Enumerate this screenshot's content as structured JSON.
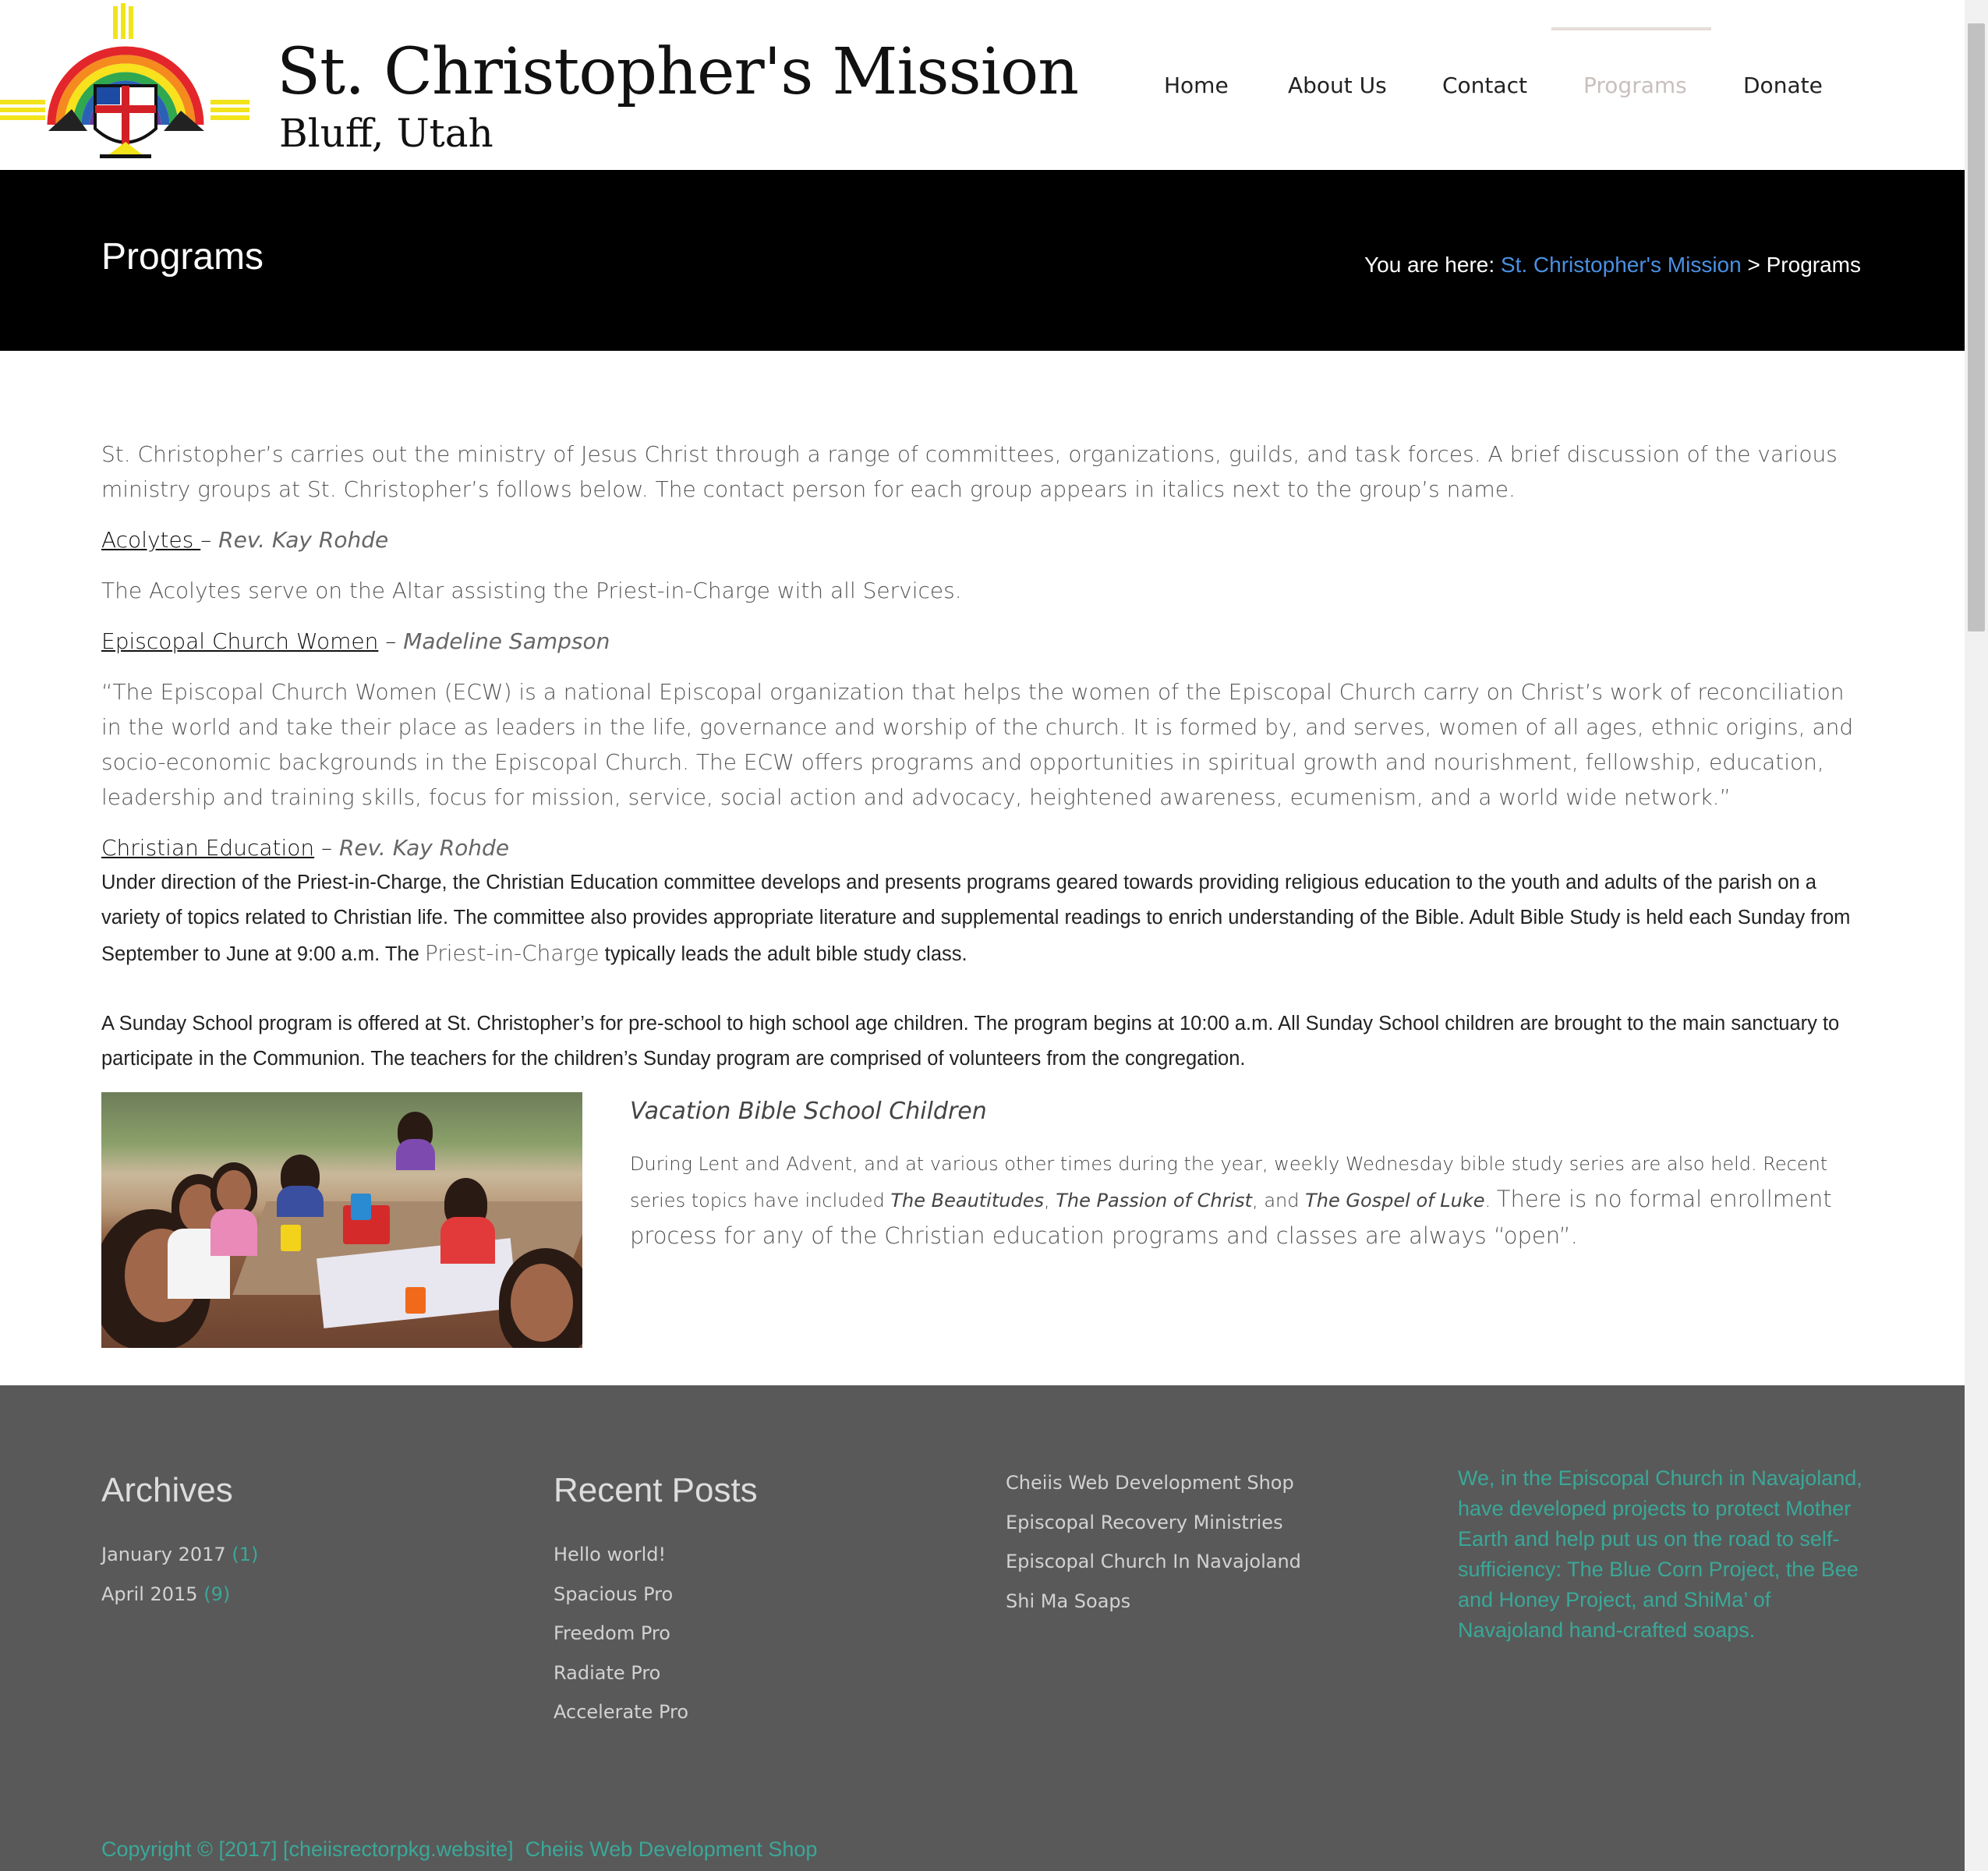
{
  "site": {
    "title": "St. Christopher's Mission",
    "tagline": "Bluff, Utah"
  },
  "nav": {
    "items": [
      {
        "label": "Home"
      },
      {
        "label": "About Us"
      },
      {
        "label": "Contact"
      },
      {
        "label": "Programs",
        "active": true
      },
      {
        "label": "Donate"
      }
    ]
  },
  "page_header": {
    "title": "Programs",
    "breadcrumb_prefix": "You are here:",
    "breadcrumb_link": "St. Christopher's Mission",
    "breadcrumb_sep": ">",
    "breadcrumb_current": "Programs"
  },
  "content": {
    "intro": "St. Christopher’s carries out the ministry of Jesus Christ through a range of committees, organizations, guilds, and task forces.  A brief discussion of the various ministry groups at St. Christopher’s follows below.  The contact person for each group appears in italics next to the group’s name.",
    "sections": [
      {
        "title": "Acolytes ",
        "dash": " – ",
        "contact": "Rev. Kay Rohde",
        "body": "The Acolytes serve on the Altar assisting the Priest-in-Charge with all Services."
      },
      {
        "title": "Episcopal Church Women",
        "dash": " – ",
        "contact": "Madeline Sampson",
        "body": "“The Episcopal Church Women (ECW) is a national Episcopal organization that helps the women of the Episcopal Church carry on Christ’s work of reconciliation in the world and take their place as leaders in the life, governance and worship of the church.  It is formed by, and serves, women of all ages, ethnic origins, and socio-economic backgrounds in the Episcopal Church.  The ECW offers programs and opportunities in spiritual growth and nourishment, fellowship, education, leadership and training skills, focus for mission, service, social action and advocacy, heightened awareness, ecumenism, and a world wide network.”"
      },
      {
        "title": "Christian Education",
        "dash": " – ",
        "contact": "Rev. Kay Rohde",
        "body_part1": "Under direction of the Priest-in-Charge, the Christian Education committee develops and presents programs geared towards providing religious education to the youth and adults of the parish on a variety of topics related to Christian life.  The committee also provides appropriate literature and supplemental readings to enrich understanding of the Bible.  Adult Bible Study is held each Sunday from September to June at 9:00 a.m.  The ",
        "body_part2": "Priest-in-Charge",
        "body_part3": " typically leads the adult bible study class.",
        "sunday_school": "A Sunday School program is offered at St. Christopher’s for pre-school to high school age children.  The program begins at 10:00 a.m. All Sunday School children are brought to the main sanctuary to participate in the Communion.  The teachers for the children’s Sunday program are comprised of volunteers from the congregation."
      }
    ],
    "vbs": {
      "caption": "Vacation Bible School Children",
      "text1": "During Lent and Advent, and at various other times during the year, weekly Wednesday bible study series are also held. Recent series topics have included ",
      "topic1": "The Beautitudes",
      "sep1": ", ",
      "topic2": "The Passion of Christ",
      "sep2": ", and ",
      "topic3": "The Gospel of Luke",
      "text2": ". ",
      "text3": "There is no formal enrollment process for any of the Christian education programs and classes are always “open”."
    }
  },
  "footer": {
    "archives": {
      "heading": "Archives",
      "items": [
        {
          "label": "January 2017",
          "count": "(1)"
        },
        {
          "label": "April 2015",
          "count": "(9)"
        }
      ]
    },
    "recent_posts": {
      "heading": "Recent Posts",
      "items": [
        "Hello world!",
        "Spacious Pro",
        "Freedom Pro",
        "Radiate Pro",
        "Accelerate Pro"
      ]
    },
    "links": {
      "items": [
        "Cheiis Web Development Shop",
        "Episcopal Recovery Ministries",
        "Episcopal Church In Navajoland",
        "Shi Ma Soaps"
      ]
    },
    "about_text": "We, in the Episcopal Church in Navajoland, have developed projects to protect Mother Earth and help put us on the road to self-sufficiency: The Blue Corn Project, the Bee and Honey Project, and ShiMa’ of Navajoland hand-crafted soaps.",
    "copyright": "Copyright © [2017] [cheiisrectorpkg.website]",
    "copyright_link": "Cheiis Web Development Shop"
  },
  "colors": {
    "link_blue": "#4a90e2",
    "footer_accent": "#3aa898",
    "footer_bg": "#595959",
    "band_bg": "#000000",
    "nav_active": "#c8c0bd"
  }
}
